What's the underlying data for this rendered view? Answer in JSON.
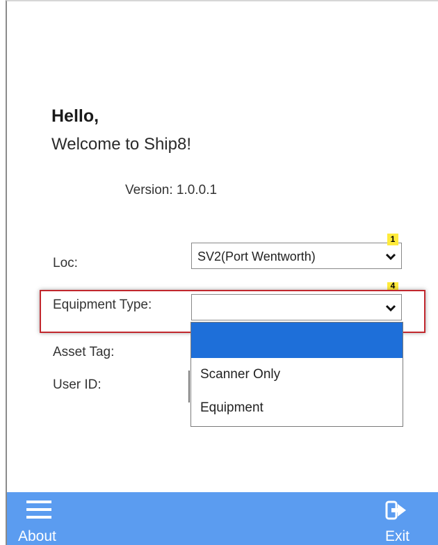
{
  "greeting": {
    "hello": "Hello,",
    "welcome": "Welcome to Ship8!"
  },
  "version_text": "Version: 1.0.0.1",
  "form": {
    "loc_label": "Loc:",
    "loc_value": "SV2(Port Wentworth)",
    "equipment_type_label": "Equipment Type:",
    "equipment_type_value": "",
    "asset_tag_label": "Asset Tag:",
    "user_id_label": "User ID:"
  },
  "badges": {
    "loc": "1",
    "equipment": "4"
  },
  "equipment_dropdown": {
    "options": [
      "",
      "Scanner Only",
      "Equipment"
    ],
    "highlighted_index": 0
  },
  "bottom_bar": {
    "about_label": "About",
    "exit_label": "Exit"
  },
  "colors": {
    "accent_bar": "#5b9cf0",
    "selection": "#1e6fd9",
    "highlight_box": "#c1272d",
    "badge": "#ffeb3b"
  },
  "icons": {
    "about": "hamburger-menu-icon",
    "exit": "exit-door-icon",
    "dropdown": "chevron-down-icon"
  }
}
